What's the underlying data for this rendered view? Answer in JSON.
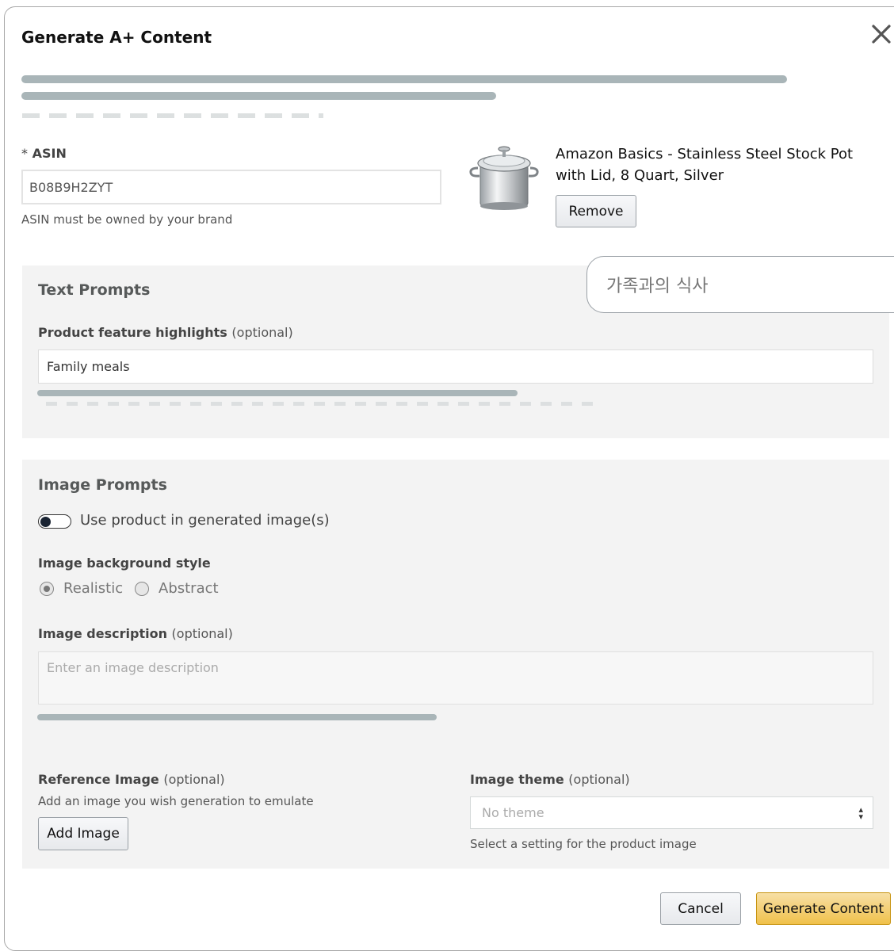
{
  "dialog": {
    "title": "Generate A+ Content",
    "close_icon": "close-icon"
  },
  "asin": {
    "label_required": "*",
    "label": "ASIN",
    "value": "B08B9H2ZYT",
    "help": "ASIN must be owned by your brand"
  },
  "product": {
    "title": "Amazon Basics - Stainless Steel Stock Pot with Lid, 8 Quart, Silver",
    "image_icon": "stock-pot-image",
    "remove_label": "Remove"
  },
  "text_prompts": {
    "section_title": "Text Prompts",
    "feature_label": "Product feature highlights",
    "feature_optional": "(optional)",
    "feature_value": "Family meals",
    "tooltip_text": "가족과의 식사"
  },
  "image_prompts": {
    "section_title": "Image Prompts",
    "toggle_label": "Use product in generated image(s)",
    "toggle_on": false,
    "background_label": "Image background style",
    "background_options": [
      "Realistic",
      "Abstract"
    ],
    "background_selected": "Realistic",
    "description_label": "Image description",
    "description_optional": "(optional)",
    "description_placeholder": "Enter an image description",
    "reference_label": "Reference Image",
    "reference_optional": "(optional)",
    "reference_help": "Add an image you wish generation to emulate",
    "add_image_label": "Add Image",
    "theme_label": "Image theme",
    "theme_optional": "(optional)",
    "theme_value": "No theme",
    "theme_help": "Select a setting for the product image"
  },
  "footer": {
    "cancel_label": "Cancel",
    "generate_label": "Generate Content"
  },
  "colors": {
    "primary_button": "#f0c14b",
    "panel_bg": "#f3f3f3",
    "placeholder_bar": "#a9b5b8"
  }
}
